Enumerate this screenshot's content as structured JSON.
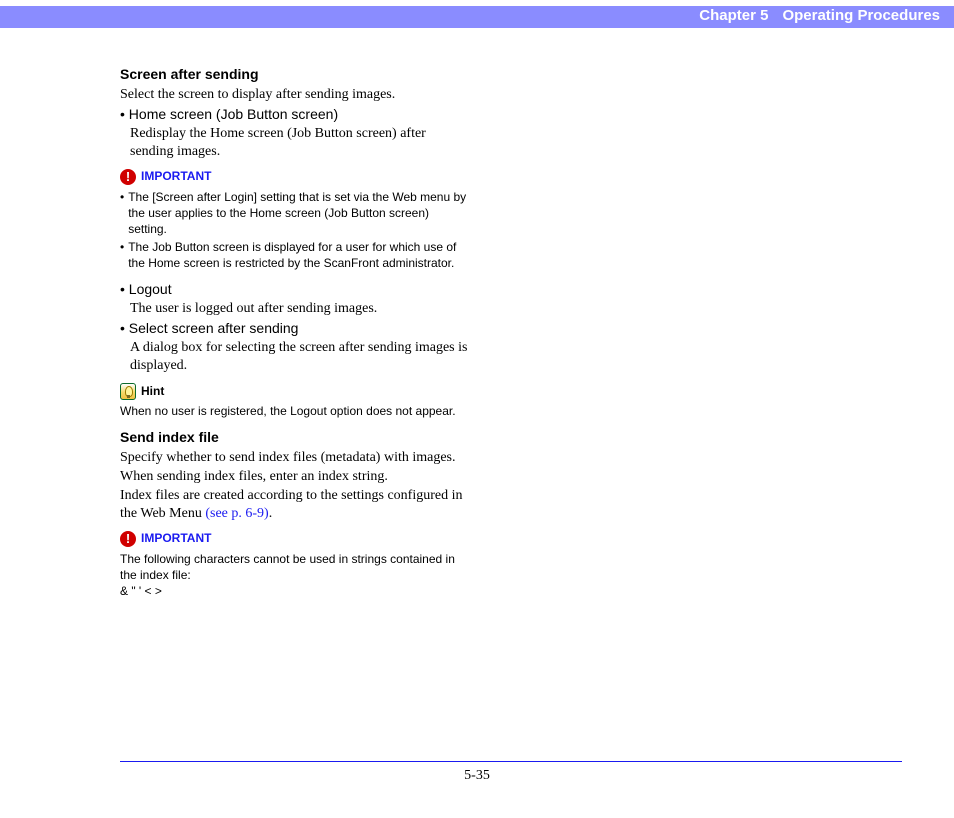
{
  "header": {
    "chapter": "Chapter 5",
    "title": "Operating Procedures"
  },
  "sections": {
    "screenAfterSending": {
      "heading": "Screen after sending",
      "intro": "Select the screen to display after sending images.",
      "homeBulletLabel": "• Home screen (Job Button screen)",
      "homeBulletDesc": "Redisplay the Home screen (Job Button screen) after sending images.",
      "important1": {
        "iconGlyph": "!",
        "label": "IMPORTANT",
        "items": [
          "The [Screen after Login] setting that is set via the Web menu by the user applies to the Home screen (Job Button screen) setting.",
          "The Job Button screen is displayed for a user for which use of the Home screen is restricted by the ScanFront administrator."
        ]
      },
      "logoutBulletLabel": "• Logout",
      "logoutBulletDesc": "The user is logged out after sending images.",
      "selectBulletLabel": "• Select screen after sending",
      "selectBulletDesc": "A dialog box for selecting the screen after sending images is displayed.",
      "hint": {
        "label": "Hint",
        "text": "When no user is registered, the Logout option does not appear."
      }
    },
    "sendIndexFile": {
      "heading": "Send index file",
      "p1": "Specify whether to send index files (metadata) with images.",
      "p2": "When sending index files, enter an index string.",
      "p3_pre": "Index files are created according to the settings configured in the Web Menu ",
      "p3_link": "(see p. 6-9)",
      "p3_post": ".",
      "important2": {
        "iconGlyph": "!",
        "label": "IMPORTANT",
        "line1": "The following characters cannot be used in strings contained in the index file:",
        "line2": "& \" ' < >"
      }
    }
  },
  "footer": {
    "pageNumber": "5-35"
  }
}
